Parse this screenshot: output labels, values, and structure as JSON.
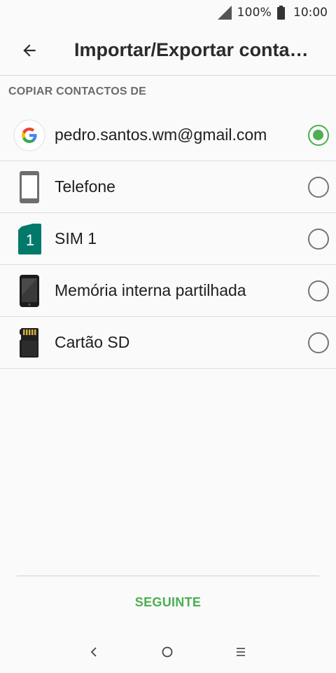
{
  "status_bar": {
    "battery_percent": "100%",
    "time": "10:00",
    "signal_icon": "signal-icon",
    "battery_icon": "battery-icon"
  },
  "app_bar": {
    "title": "Importar/Exportar contactos",
    "back_icon": "arrow-back-icon"
  },
  "section": {
    "header": "COPIAR CONTACTOS DE"
  },
  "options": [
    {
      "label": "pedro.santos.wm@gmail.com",
      "icon": "google-icon",
      "selected": true
    },
    {
      "label": "Telefone",
      "icon": "phone-icon",
      "selected": false
    },
    {
      "label": "SIM 1",
      "icon": "sim-card-icon",
      "sim_number": "1",
      "selected": false
    },
    {
      "label": "Memória interna partilhada",
      "icon": "device-storage-icon",
      "selected": false
    },
    {
      "label": "Cartão SD",
      "icon": "sd-card-icon",
      "selected": false
    }
  ],
  "actions": {
    "next_label": "SEGUINTE"
  },
  "colors": {
    "accent": "#4caf50",
    "sim_green": "#00796b",
    "radio_off": "#757575"
  },
  "nav": {
    "back_icon": "nav-back-icon",
    "home_icon": "nav-home-icon",
    "recents_icon": "nav-recents-icon"
  }
}
